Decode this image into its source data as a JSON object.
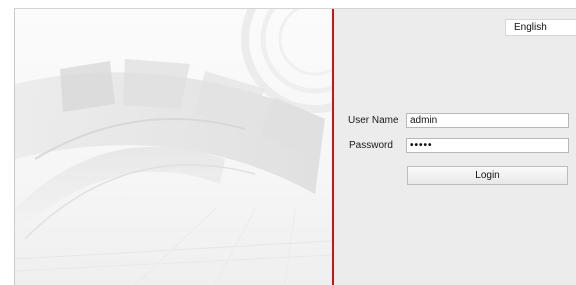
{
  "header": {
    "language": "English"
  },
  "login": {
    "username_label": "User Name",
    "username_value": "admin",
    "password_label": "Password",
    "password_value": "•••••",
    "login_button": "Login"
  },
  "colors": {
    "divider": "#c8141b",
    "panel_background": "#ececec",
    "left_background": "#f6f6f6"
  },
  "icons": [
    "decorative-arc-graphic"
  ]
}
